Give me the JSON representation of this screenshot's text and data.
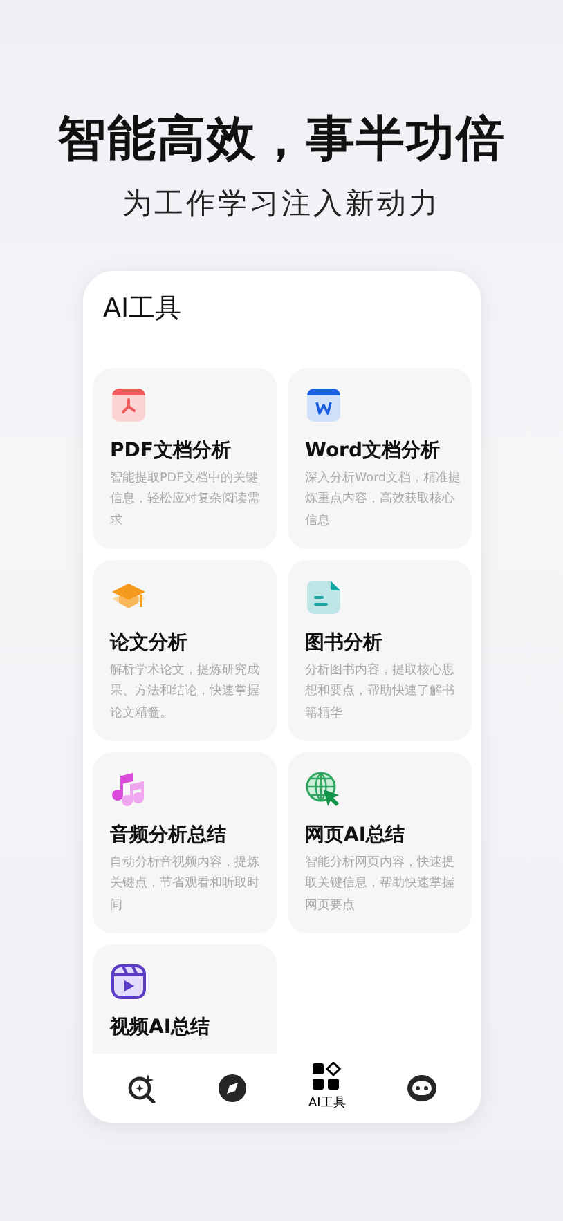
{
  "headline": "智能高效，事半功倍",
  "subheadline": "为工作学习注入新动力",
  "panel": {
    "title": "AI工具"
  },
  "tools": [
    {
      "kind": "pdf",
      "name": "PDF文档分析",
      "description": "智能提取PDF文档中的关键信息，轻松应对复杂阅读需求"
    },
    {
      "kind": "word",
      "name": "Word文档分析",
      "description": "深入分析Word文档，精准提炼重点内容，高效获取核心信息"
    },
    {
      "kind": "cap",
      "name": "论文分析",
      "description": "解析学术论文，提炼研究成果、方法和结论，快速掌握论文精髓。"
    },
    {
      "kind": "book",
      "name": "图书分析",
      "description": "分析图书内容，提取核心思想和要点，帮助快速了解书籍精华"
    },
    {
      "kind": "music",
      "name": "音频分析总结",
      "description": "自动分析音视频内容，提炼关键点，节省观看和听取时间"
    },
    {
      "kind": "globe",
      "name": "网页AI总结",
      "description": "智能分析网页内容，快速提取关键信息，帮助快速掌握网页要点"
    },
    {
      "kind": "video",
      "name": "视频AI总结"
    }
  ],
  "tabs": [
    {
      "kind": "search",
      "selected": false
    },
    {
      "kind": "compass",
      "selected": false
    },
    {
      "kind": "tools",
      "label": "AI工具",
      "selected": true
    },
    {
      "kind": "robot",
      "selected": false
    }
  ]
}
